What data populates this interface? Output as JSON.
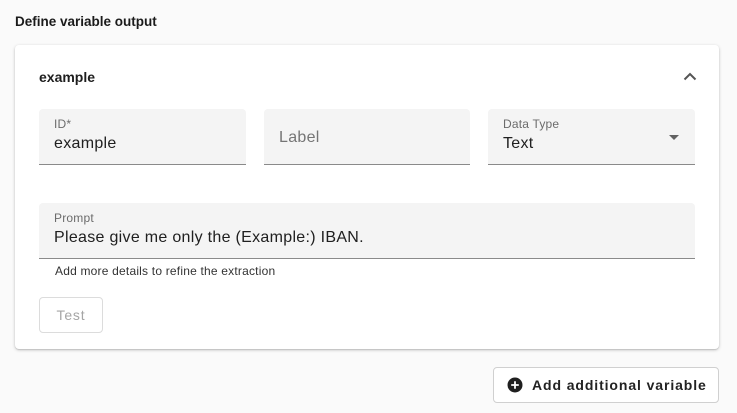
{
  "section": {
    "title": "Define variable output"
  },
  "card": {
    "title": "example",
    "fields": {
      "id": {
        "label": "ID*",
        "value": "example"
      },
      "label": {
        "placeholder": "Label"
      },
      "data_type": {
        "label": "Data Type",
        "value": "Text"
      },
      "prompt": {
        "label": "Prompt",
        "value": "Please give me only the (Example:) IBAN."
      }
    },
    "hint": "Add more details to refine the extraction",
    "test_label": "Test"
  },
  "actions": {
    "add_variable_label": "Add additional variable"
  },
  "icons": {
    "collapse": "chevron-up-icon",
    "add": "plus-circle-icon"
  },
  "colors": {
    "field_bg": "#f4f4f4",
    "disabled_text": "#a5a5a5",
    "accent": "#212121"
  }
}
